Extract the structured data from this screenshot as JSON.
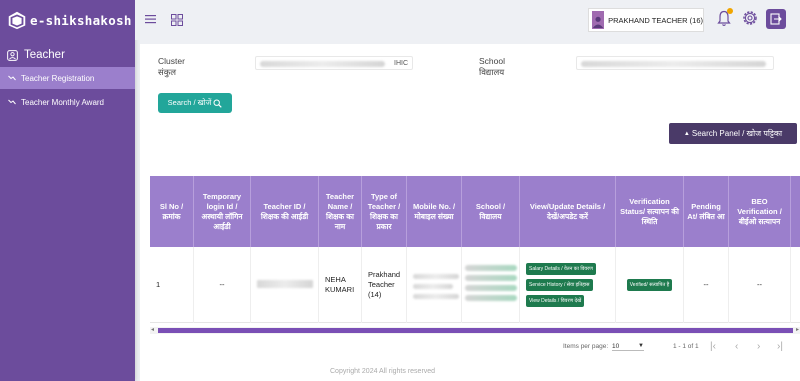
{
  "app": {
    "logo_text": "e-shikshakosh"
  },
  "sidebar": {
    "section": "Teacher",
    "items": [
      {
        "label": "Teacher Registration"
      },
      {
        "label": "Teacher Monthly Award"
      }
    ]
  },
  "header": {
    "user_name": "PRAKHAND TEACHER (16)"
  },
  "filters": {
    "cluster_label_en": "Cluster",
    "cluster_label_hi": "संकुल",
    "cluster_value": "IHIC",
    "school_label_en": "School",
    "school_label_hi": "विद्यालय",
    "search_button": "Search / खोजें"
  },
  "search_panel_button": "Search Panel / खोज पट्टिका",
  "table": {
    "headers": [
      "Sl No / क्रमांक",
      "Temporary login Id / अस्थायी लॉगिन आईडी",
      "Teacher ID / शिक्षक की आईडी",
      "Teacher Name / शिक्षक का नाम",
      "Type of Teacher / शिक्षक का प्रकार",
      "Mobile No. / मोबाइल संख्या",
      "School / विद्यालय",
      "View/Update Details / देखें/अपडेट करें",
      "Verification Status/ सत्यापन की स्थिति",
      "Pending At/ लंबित आ",
      "BEO Verification / बीईओ सत्यापन"
    ],
    "rows": [
      {
        "sl": "1",
        "temp_login": "--",
        "teacher_name": "NEHA KUMARI",
        "type": "Prakhand Teacher (14)",
        "actions": [
          "Salary Details / वेतन का विवरण",
          "Service History / सेवा इतिहास",
          "View Details / विवरण देखें"
        ],
        "status": "Verified/ सत्यापित है",
        "pending": "--",
        "beo": "--"
      }
    ]
  },
  "paginator": {
    "items_per_page_label": "Items per page:",
    "page_size": "10",
    "range": "1 - 1 of 1"
  },
  "footer": "Copyright 2024 All rights reserved",
  "colors": {
    "primary": "#6c4c9c",
    "header": "#9b7fcc",
    "accent": "#22a69a",
    "verified": "#1e7a4e"
  }
}
